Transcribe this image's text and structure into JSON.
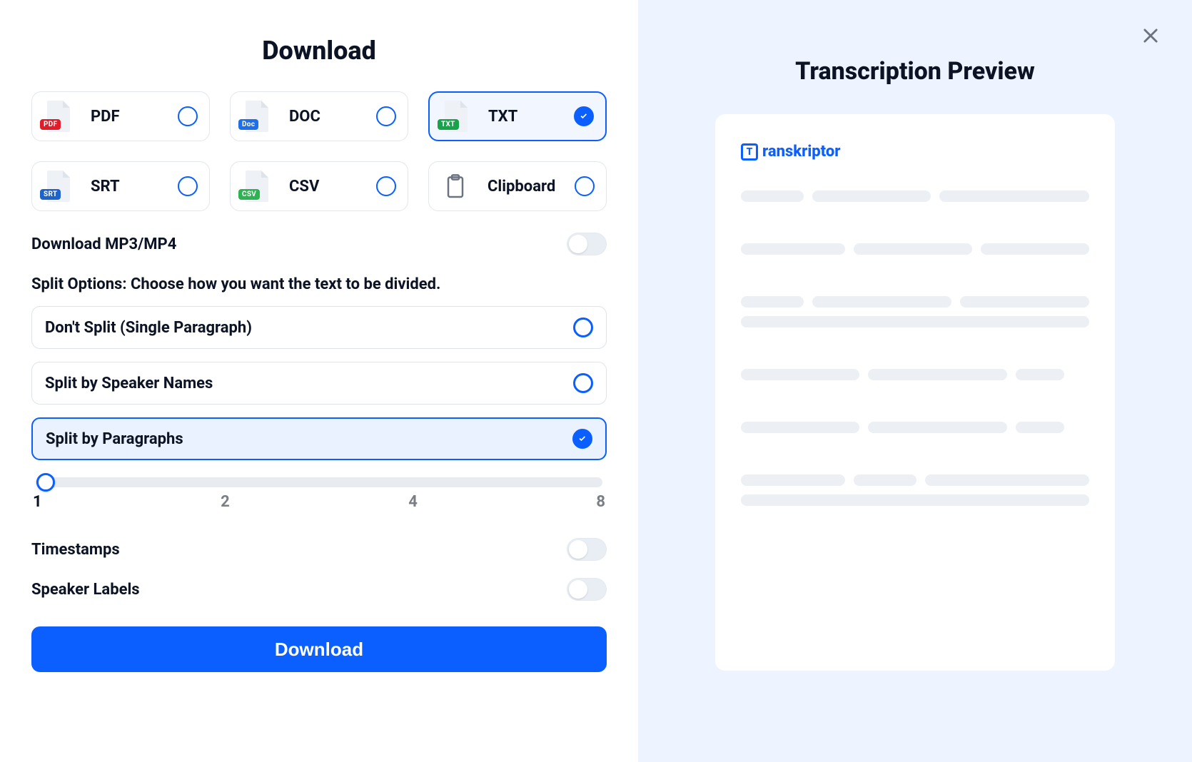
{
  "header": {
    "title": "Download"
  },
  "formats": {
    "selected": "TXT",
    "items": [
      {
        "key": "PDF",
        "label": "PDF",
        "badge_class": "pdf"
      },
      {
        "key": "DOC",
        "label": "DOC",
        "badge_class": "doc"
      },
      {
        "key": "TXT",
        "label": "TXT",
        "badge_class": "txt"
      },
      {
        "key": "SRT",
        "label": "SRT",
        "badge_class": "srt"
      },
      {
        "key": "CSV",
        "label": "CSV",
        "badge_class": "csv"
      },
      {
        "key": "CLIP",
        "label": "Clipboard",
        "badge_class": ""
      }
    ]
  },
  "toggles": {
    "download_media_label": "Download MP3/MP4",
    "download_media_on": false,
    "timestamps_label": "Timestamps",
    "timestamps_on": false,
    "speaker_labels_label": "Speaker Labels",
    "speaker_labels_on": false
  },
  "split": {
    "section_label": "Split Options: Choose how you want the text to be divided.",
    "selected": "paragraphs",
    "options": [
      {
        "key": "none",
        "label": "Don't Split (Single Paragraph)"
      },
      {
        "key": "speaker",
        "label": "Split by Speaker Names"
      },
      {
        "key": "paragraphs",
        "label": "Split by Paragraphs"
      }
    ],
    "slider": {
      "min": 1,
      "max": 8,
      "value": 1,
      "ticks": [
        "1",
        "2",
        "4",
        "8"
      ]
    }
  },
  "buttons": {
    "download_label": "Download"
  },
  "preview": {
    "title": "Transcription Preview",
    "brand_name": "ranskriptor",
    "brand_initial": "T"
  },
  "colors": {
    "accent": "#0b5fff",
    "panel_bg": "#eef4ff",
    "skeleton": "#eceff3"
  }
}
